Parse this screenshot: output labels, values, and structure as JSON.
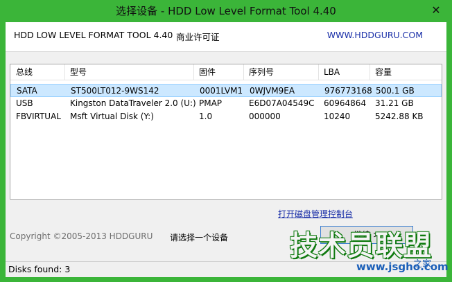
{
  "window": {
    "title": "选择设备 - HDD Low Level Format Tool 4.40",
    "close_glyph": "✕"
  },
  "header": {
    "program_name": "HDD LOW LEVEL FORMAT TOOL 4.40",
    "license": "商业许可证",
    "website": "WWW.HDDGURU.COM"
  },
  "device_list": {
    "columns": [
      "总线",
      "型号",
      "固件",
      "序列号",
      "LBA",
      "容量"
    ],
    "rows": [
      {
        "bus": "SATA",
        "model": "ST500LT012-9WS142",
        "firmware": "0001LVM1",
        "serial": "0WJVM9EA",
        "lba": "976773168",
        "capacity": "500.1 GB",
        "selected": true
      },
      {
        "bus": "USB",
        "model": "Kingston DataTraveler 2.0 (U:)",
        "firmware": "PMAP",
        "serial": "E6D07A04549C",
        "lba": "60964864",
        "capacity": "31.21 GB",
        "selected": false
      },
      {
        "bus": "FBVIRTUAL",
        "model": "Msft Virtual Disk (Y:)",
        "firmware": "1.0",
        "serial": "000000",
        "lba": "10240",
        "capacity": "5242.88 KB",
        "selected": false
      }
    ]
  },
  "disk_management_link": "打开磁盘管理控制台",
  "copyright": "Copyright ©2005-2013 HDDGURU",
  "select_hint": "请选择一个设备",
  "continue_button": "继续 >",
  "status": {
    "disks_found": "Disks found: 3"
  },
  "watermark": {
    "main": "技术员联盟",
    "small": "www.jsgho.com",
    "tag": "之家"
  }
}
